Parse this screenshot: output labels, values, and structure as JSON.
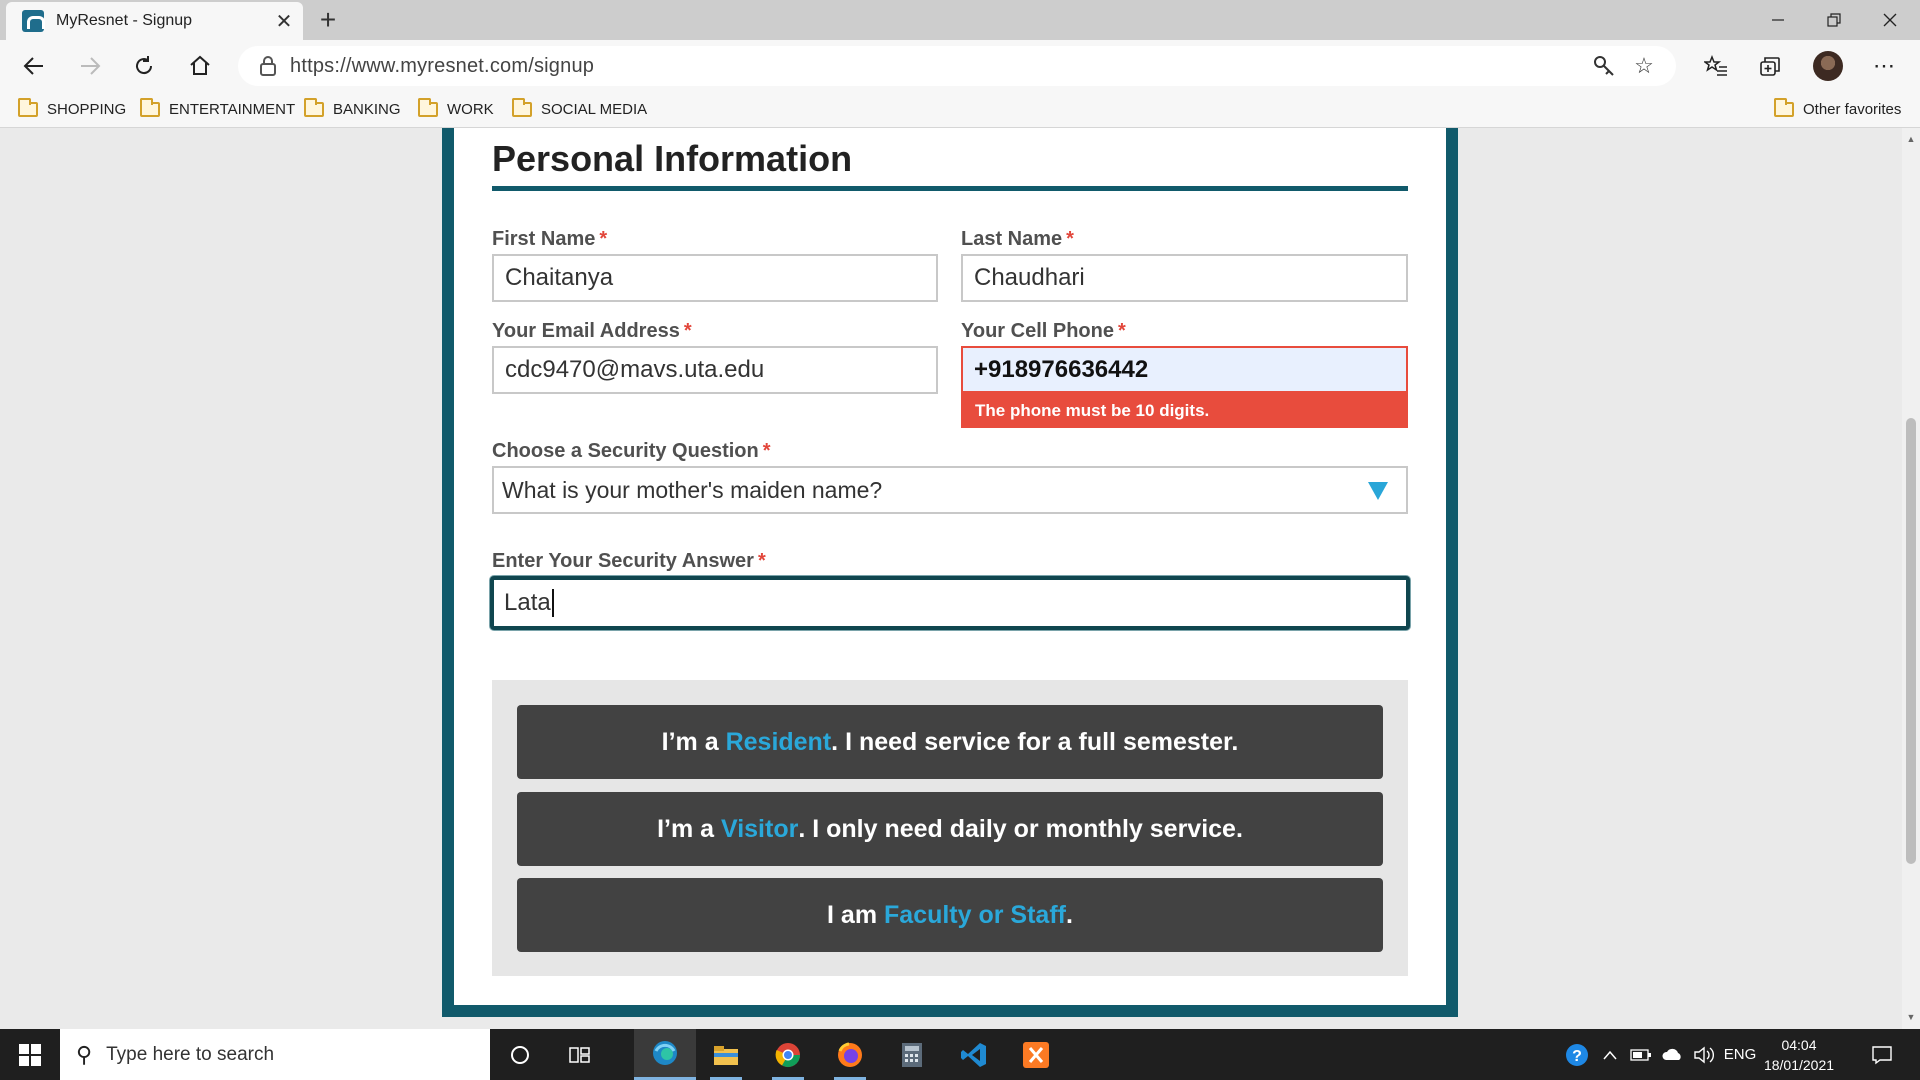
{
  "browser": {
    "tab_title": "MyResnet - Signup",
    "url": "https://www.myresnet.com/signup",
    "new_tab_label": "+",
    "bookmarks": [
      "SHOPPING",
      "ENTERTAINMENT",
      "BANKING",
      "WORK",
      "SOCIAL MEDIA"
    ],
    "other_favorites": "Other favorites"
  },
  "form": {
    "section_title": "Personal Information",
    "required_marker": "*",
    "first_name": {
      "label": "First Name",
      "value": "Chaitanya"
    },
    "last_name": {
      "label": "Last Name",
      "value": "Chaudhari"
    },
    "email": {
      "label": "Your Email Address",
      "value": "cdc9470@mavs.uta.edu"
    },
    "phone": {
      "label": "Your Cell Phone",
      "value": "+918976636442",
      "error": "The phone must be 10 digits."
    },
    "security_question": {
      "label": "Choose a Security Question",
      "value": "What is your mother's maiden name?"
    },
    "security_answer": {
      "label": "Enter Your Security Answer",
      "value": "Lata"
    }
  },
  "options": [
    {
      "prefix": "I’m a ",
      "highlight": "Resident",
      "suffix": ". I need service for a full semester."
    },
    {
      "prefix": "I’m a ",
      "highlight": "Visitor",
      "suffix": ". I only need daily or monthly service."
    },
    {
      "prefix": "I am ",
      "highlight": "Faculty or Staff",
      "suffix": "."
    }
  ],
  "taskbar": {
    "search_placeholder": "Type here to search",
    "language": "ENG",
    "time": "04:04",
    "date": "18/01/2021",
    "pinned_apps": [
      "task-view",
      "edge",
      "file-explorer",
      "chrome",
      "firefox",
      "calculator",
      "vscode",
      "xampp"
    ]
  },
  "colors": {
    "brand_teal": "#115a6b",
    "accent_blue": "#2aa8da",
    "error_red": "#e84c3d",
    "option_button": "#424242"
  }
}
